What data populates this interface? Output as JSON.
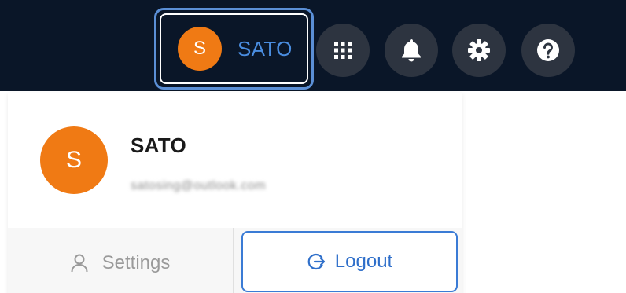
{
  "header": {
    "user_button": {
      "initial": "S",
      "name": "SATO"
    },
    "icons": [
      "apps-grid-icon",
      "bell-icon",
      "gear-icon",
      "help-icon"
    ]
  },
  "user_menu": {
    "avatar_initial": "S",
    "name": "SATO",
    "email": "satosing@outlook.com",
    "settings_label": "Settings",
    "logout_label": "Logout"
  },
  "colors": {
    "topbar": "#0a1628",
    "avatar": "#f07a14",
    "accent": "#3a7bd5",
    "focus_ring": "#5b8fd6"
  }
}
